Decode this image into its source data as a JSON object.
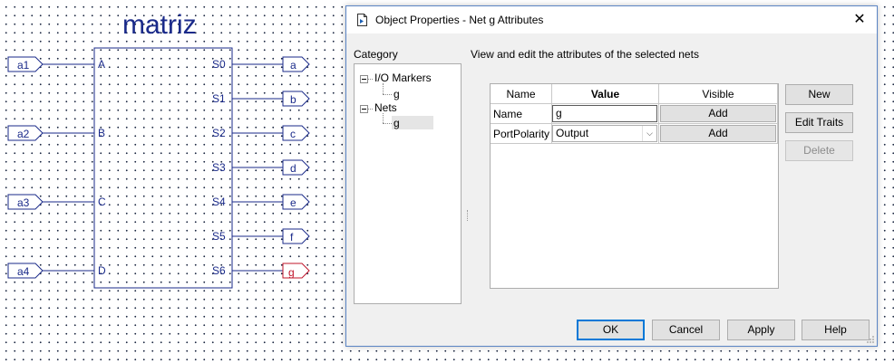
{
  "schematic": {
    "title": "matriz",
    "block": {
      "inputs": [
        "A",
        "B",
        "C",
        "D"
      ],
      "outputs": [
        "S0",
        "S1",
        "S2",
        "S3",
        "S4",
        "S5",
        "S6"
      ]
    },
    "input_markers": [
      "a1",
      "a2",
      "a3",
      "a4"
    ],
    "output_markers": [
      "a",
      "b",
      "c",
      "d",
      "e",
      "f",
      "g"
    ],
    "selected_marker": "g",
    "colors": {
      "wire": "#1a2a8a",
      "selected": "#c0142a"
    }
  },
  "dialog": {
    "title": "Object Properties - Net g Attributes",
    "close_glyph": "✕",
    "category_label": "Category",
    "description": "View and edit the attributes of the selected nets",
    "tree": {
      "io_markers": "I/O Markers",
      "io_child": "g",
      "nets": "Nets",
      "nets_child": "g"
    },
    "grid": {
      "headers": {
        "name": "Name",
        "value": "Value",
        "visible": "Visible"
      },
      "rows": [
        {
          "name": "Name",
          "value": "g",
          "visible_button": "Add"
        },
        {
          "name": "PortPolarity",
          "value": "Output",
          "visible_button": "Add"
        }
      ]
    },
    "side_buttons": {
      "new": "New",
      "edit_traits": "Edit Traits",
      "delete": "Delete"
    },
    "bottom_buttons": {
      "ok": "OK",
      "cancel": "Cancel",
      "apply": "Apply",
      "help": "Help"
    }
  }
}
